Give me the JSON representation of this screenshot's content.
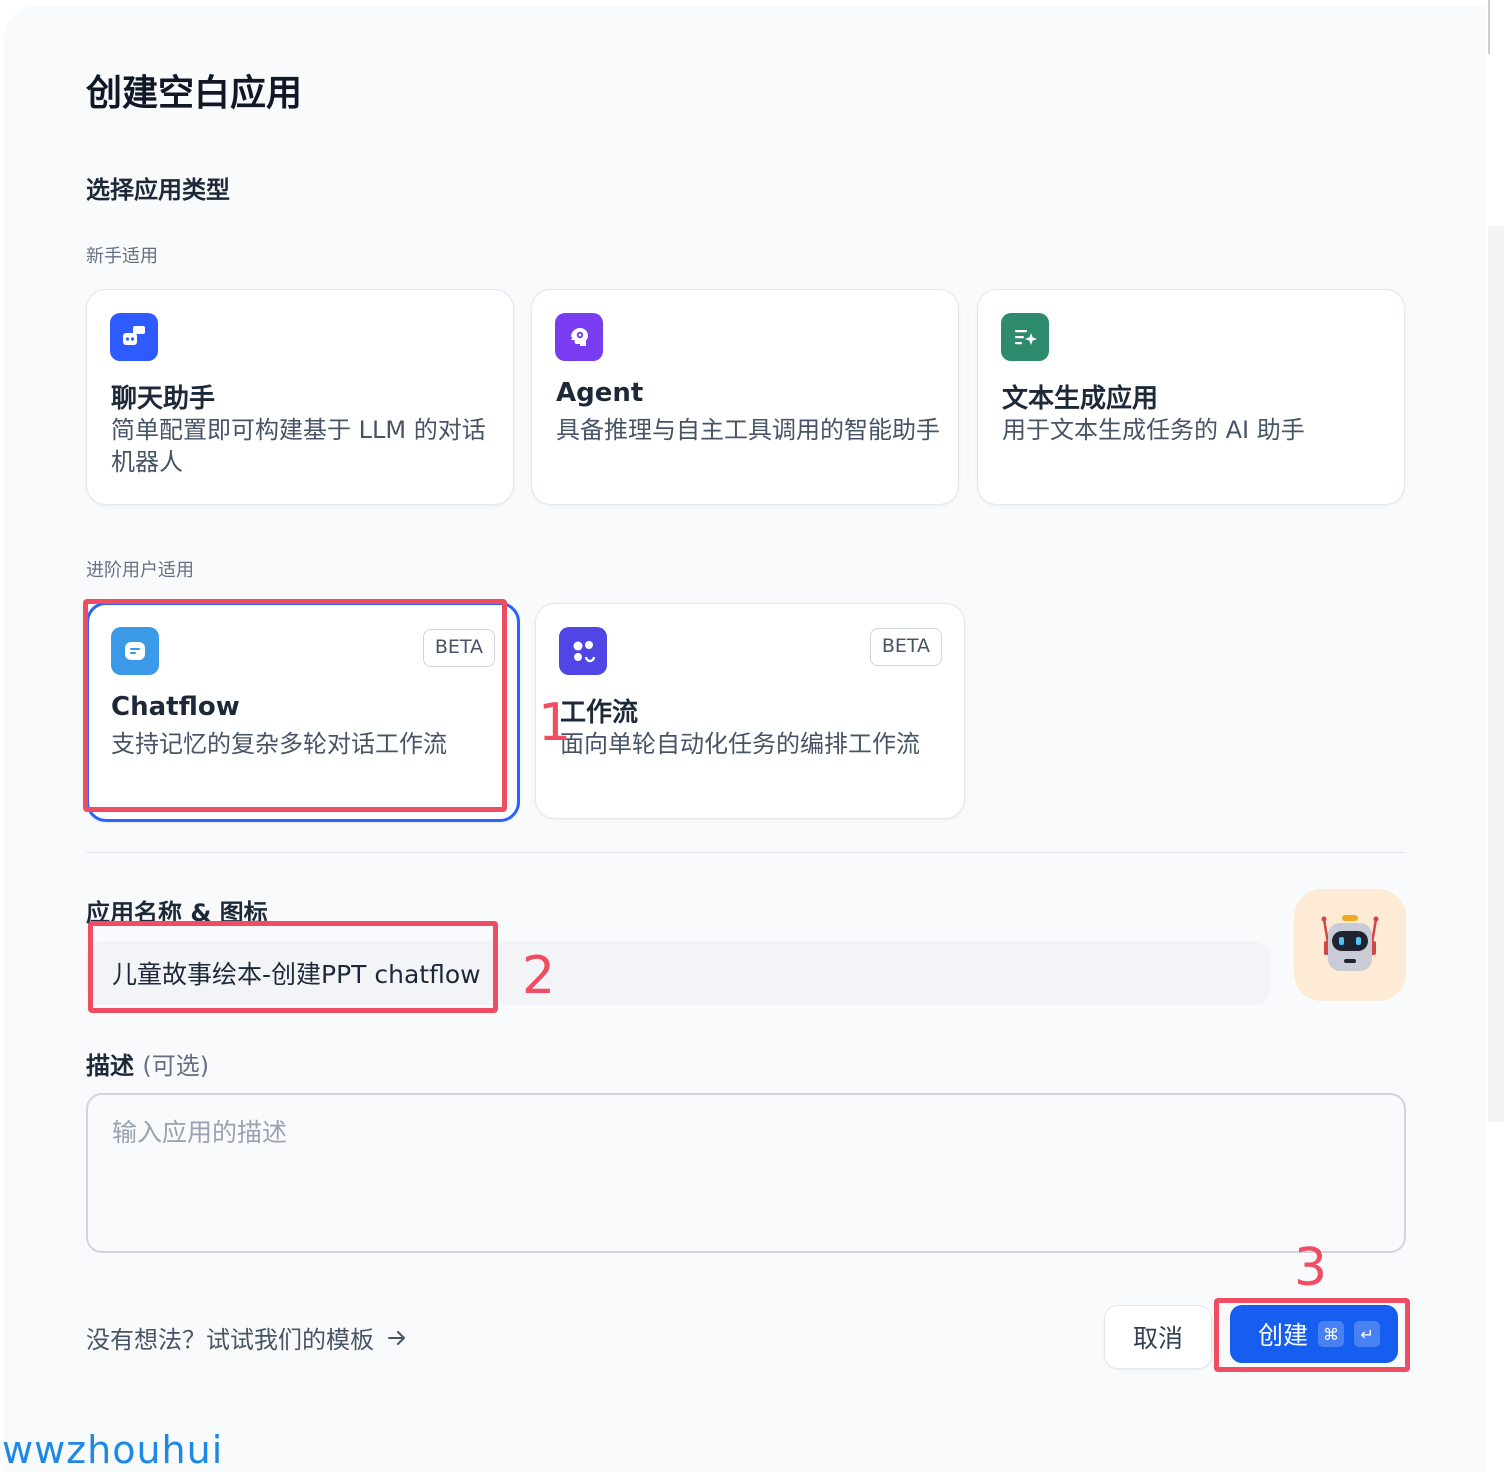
{
  "dialog": {
    "title": "创建空白应用",
    "section_title": "选择应用类型"
  },
  "groups": {
    "beginner": "新手适用",
    "advanced": "进阶用户适用"
  },
  "app_types": [
    {
      "name": "聊天助手",
      "desc": "简单配置即可构建基于 LLM 的对话机器人",
      "icon": "chatbot-icon",
      "color": "#2e5bff"
    },
    {
      "name": "Agent",
      "desc": "具备推理与自主工具调用的智能助手",
      "icon": "agent-brain-icon",
      "color": "#7a3cf0"
    },
    {
      "name": "文本生成应用",
      "desc": "用于文本生成任务的 AI 助手",
      "icon": "text-generation-icon",
      "color": "#2e8b6e"
    },
    {
      "name": "Chatflow",
      "desc": "支持记忆的复杂多轮对话工作流",
      "badge": "BETA",
      "icon": "chatflow-icon",
      "color": "#3b9ae8",
      "selected": true
    },
    {
      "name": "工作流",
      "desc": "面向单轮自动化任务的编排工作流",
      "badge": "BETA",
      "icon": "workflow-icon",
      "color": "#4f46e5"
    }
  ],
  "form": {
    "name_label": "应用名称 & 图标",
    "name_value": "儿童故事绘本-创建PPT chatflow",
    "avatar_icon": "robot-avatar-icon",
    "desc_label": "描述",
    "desc_optional": "(可选)",
    "desc_placeholder": "输入应用的描述"
  },
  "footer": {
    "template_link": "没有想法？试试我们的模板",
    "cancel": "取消",
    "create": "创建",
    "shortcut_cmd": "⌘",
    "shortcut_enter": "↵"
  },
  "annotations": [
    "1",
    "2",
    "3"
  ],
  "watermark": "wwzhouhui",
  "colors": {
    "accent": "#155eef",
    "annotation": "#f04d62",
    "selected_border": "#2962ff"
  }
}
